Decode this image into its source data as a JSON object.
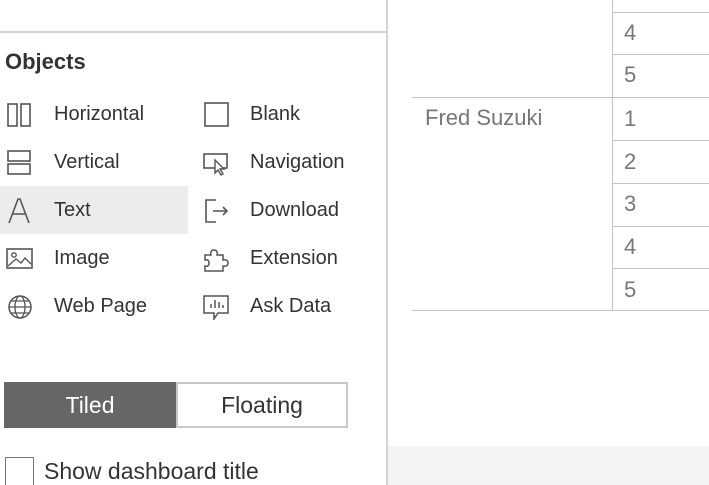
{
  "objects_panel": {
    "title": "Objects",
    "items": [
      {
        "label": "Horizontal",
        "icon": "horizontal-layout-icon"
      },
      {
        "label": "Blank",
        "icon": "blank-icon"
      },
      {
        "label": "Vertical",
        "icon": "vertical-layout-icon"
      },
      {
        "label": "Navigation",
        "icon": "navigation-icon"
      },
      {
        "label": "Text",
        "icon": "text-icon",
        "selected": true
      },
      {
        "label": "Download",
        "icon": "download-icon"
      },
      {
        "label": "Image",
        "icon": "image-icon"
      },
      {
        "label": "Extension",
        "icon": "extension-icon"
      },
      {
        "label": "Web Page",
        "icon": "web-page-icon"
      },
      {
        "label": "Ask Data",
        "icon": "ask-data-icon"
      }
    ]
  },
  "layout_toggle": {
    "tiled_label": "Tiled",
    "floating_label": "Floating",
    "selected": "Tiled"
  },
  "show_title": {
    "label": "Show dashboard title",
    "checked": false
  },
  "view_table": {
    "partial_top_values": [
      "4",
      "5"
    ],
    "rows": [
      {
        "name": "Fred Suzuki",
        "values": [
          "1",
          "2",
          "3",
          "4",
          "5"
        ]
      }
    ]
  },
  "colors": {
    "tiled_active_bg": "#666666",
    "selected_item_bg": "#ececec",
    "divider": "#d4d4d4"
  }
}
